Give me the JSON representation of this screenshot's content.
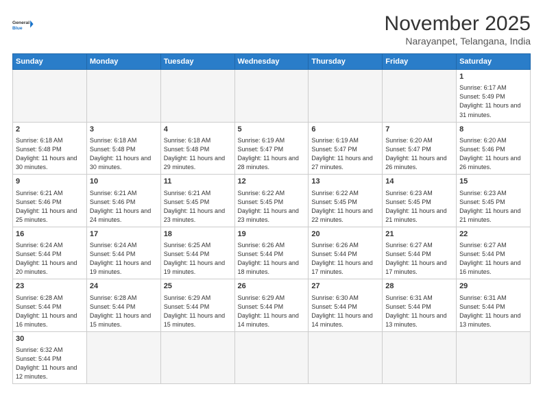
{
  "header": {
    "logo_general": "General",
    "logo_blue": "Blue",
    "month_title": "November 2025",
    "subtitle": "Narayanpet, Telangana, India"
  },
  "weekdays": [
    "Sunday",
    "Monday",
    "Tuesday",
    "Wednesday",
    "Thursday",
    "Friday",
    "Saturday"
  ],
  "weeks": [
    [
      {
        "day": "",
        "empty": true
      },
      {
        "day": "",
        "empty": true
      },
      {
        "day": "",
        "empty": true
      },
      {
        "day": "",
        "empty": true
      },
      {
        "day": "",
        "empty": true
      },
      {
        "day": "",
        "empty": true
      },
      {
        "day": "1",
        "sunrise": "6:17 AM",
        "sunset": "5:49 PM",
        "daylight": "11 hours and 31 minutes."
      }
    ],
    [
      {
        "day": "2",
        "sunrise": "6:18 AM",
        "sunset": "5:48 PM",
        "daylight": "11 hours and 30 minutes."
      },
      {
        "day": "3",
        "sunrise": "6:18 AM",
        "sunset": "5:48 PM",
        "daylight": "11 hours and 30 minutes."
      },
      {
        "day": "4",
        "sunrise": "6:18 AM",
        "sunset": "5:48 PM",
        "daylight": "11 hours and 29 minutes."
      },
      {
        "day": "5",
        "sunrise": "6:19 AM",
        "sunset": "5:47 PM",
        "daylight": "11 hours and 28 minutes."
      },
      {
        "day": "6",
        "sunrise": "6:19 AM",
        "sunset": "5:47 PM",
        "daylight": "11 hours and 27 minutes."
      },
      {
        "day": "7",
        "sunrise": "6:20 AM",
        "sunset": "5:47 PM",
        "daylight": "11 hours and 26 minutes."
      },
      {
        "day": "8",
        "sunrise": "6:20 AM",
        "sunset": "5:46 PM",
        "daylight": "11 hours and 26 minutes."
      }
    ],
    [
      {
        "day": "9",
        "sunrise": "6:21 AM",
        "sunset": "5:46 PM",
        "daylight": "11 hours and 25 minutes."
      },
      {
        "day": "10",
        "sunrise": "6:21 AM",
        "sunset": "5:46 PM",
        "daylight": "11 hours and 24 minutes."
      },
      {
        "day": "11",
        "sunrise": "6:21 AM",
        "sunset": "5:45 PM",
        "daylight": "11 hours and 23 minutes."
      },
      {
        "day": "12",
        "sunrise": "6:22 AM",
        "sunset": "5:45 PM",
        "daylight": "11 hours and 23 minutes."
      },
      {
        "day": "13",
        "sunrise": "6:22 AM",
        "sunset": "5:45 PM",
        "daylight": "11 hours and 22 minutes."
      },
      {
        "day": "14",
        "sunrise": "6:23 AM",
        "sunset": "5:45 PM",
        "daylight": "11 hours and 21 minutes."
      },
      {
        "day": "15",
        "sunrise": "6:23 AM",
        "sunset": "5:45 PM",
        "daylight": "11 hours and 21 minutes."
      }
    ],
    [
      {
        "day": "16",
        "sunrise": "6:24 AM",
        "sunset": "5:44 PM",
        "daylight": "11 hours and 20 minutes."
      },
      {
        "day": "17",
        "sunrise": "6:24 AM",
        "sunset": "5:44 PM",
        "daylight": "11 hours and 19 minutes."
      },
      {
        "day": "18",
        "sunrise": "6:25 AM",
        "sunset": "5:44 PM",
        "daylight": "11 hours and 19 minutes."
      },
      {
        "day": "19",
        "sunrise": "6:26 AM",
        "sunset": "5:44 PM",
        "daylight": "11 hours and 18 minutes."
      },
      {
        "day": "20",
        "sunrise": "6:26 AM",
        "sunset": "5:44 PM",
        "daylight": "11 hours and 17 minutes."
      },
      {
        "day": "21",
        "sunrise": "6:27 AM",
        "sunset": "5:44 PM",
        "daylight": "11 hours and 17 minutes."
      },
      {
        "day": "22",
        "sunrise": "6:27 AM",
        "sunset": "5:44 PM",
        "daylight": "11 hours and 16 minutes."
      }
    ],
    [
      {
        "day": "23",
        "sunrise": "6:28 AM",
        "sunset": "5:44 PM",
        "daylight": "11 hours and 16 minutes."
      },
      {
        "day": "24",
        "sunrise": "6:28 AM",
        "sunset": "5:44 PM",
        "daylight": "11 hours and 15 minutes."
      },
      {
        "day": "25",
        "sunrise": "6:29 AM",
        "sunset": "5:44 PM",
        "daylight": "11 hours and 15 minutes."
      },
      {
        "day": "26",
        "sunrise": "6:29 AM",
        "sunset": "5:44 PM",
        "daylight": "11 hours and 14 minutes."
      },
      {
        "day": "27",
        "sunrise": "6:30 AM",
        "sunset": "5:44 PM",
        "daylight": "11 hours and 14 minutes."
      },
      {
        "day": "28",
        "sunrise": "6:31 AM",
        "sunset": "5:44 PM",
        "daylight": "11 hours and 13 minutes."
      },
      {
        "day": "29",
        "sunrise": "6:31 AM",
        "sunset": "5:44 PM",
        "daylight": "11 hours and 13 minutes."
      }
    ],
    [
      {
        "day": "30",
        "sunrise": "6:32 AM",
        "sunset": "5:44 PM",
        "daylight": "11 hours and 12 minutes."
      },
      {
        "day": "",
        "empty": true
      },
      {
        "day": "",
        "empty": true
      },
      {
        "day": "",
        "empty": true
      },
      {
        "day": "",
        "empty": true
      },
      {
        "day": "",
        "empty": true
      },
      {
        "day": "",
        "empty": true
      }
    ]
  ],
  "colors": {
    "header_bg": "#2a7dc9",
    "logo_blue": "#1a73c9"
  }
}
